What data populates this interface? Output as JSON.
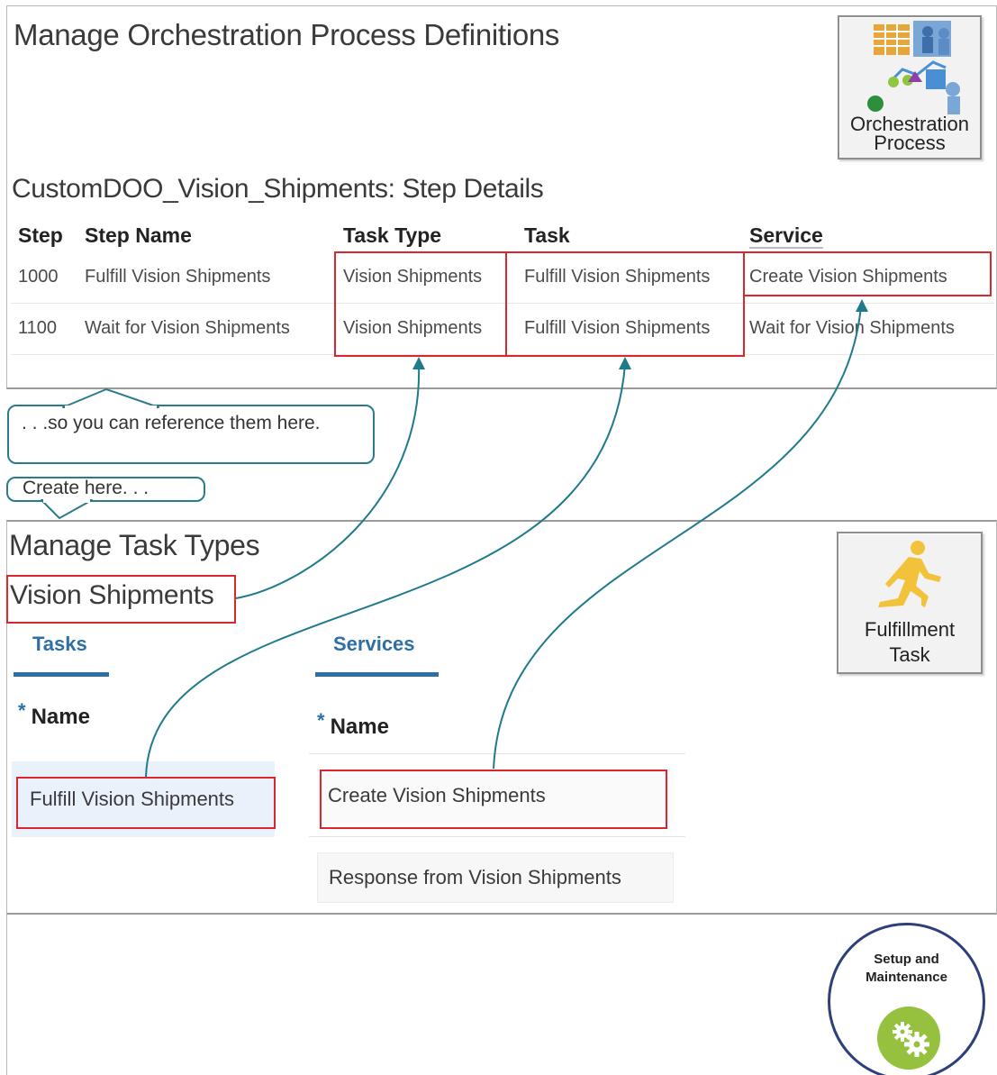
{
  "top_section": {
    "title": "Manage Orchestration Process Definitions",
    "tile_label_line1": "Orchestration",
    "tile_label_line2": "Process",
    "step_details_title": "CustomDOO_Vision_Shipments: Step Details",
    "columns": [
      "Step",
      "Step Name",
      "Task Type",
      "Task",
      "Service"
    ],
    "rows": [
      {
        "step": "1000",
        "step_name": "Fulfill Vision Shipments",
        "task_type": "Vision Shipments",
        "task": "Fulfill Vision Shipments",
        "service": "Create Vision Shipments"
      },
      {
        "step": "1100",
        "step_name": "Wait for Vision Shipments",
        "task_type": "Vision Shipments",
        "task": "Fulfill Vision Shipments",
        "service": "Wait for Vision Shipments"
      }
    ]
  },
  "callouts": {
    "reference_text": ". . .so you can reference  them here.",
    "create_text": "Create  here. . ."
  },
  "middle_section": {
    "title": "Manage Task Types",
    "task_type_name": "Vision Shipments",
    "tile_label_line1": "Fulfillment",
    "tile_label_line2": "Task",
    "tabs": {
      "tasks": "Tasks",
      "services": "Services"
    },
    "required_marker": "*",
    "name_label": "Name",
    "task_items": [
      "Fulfill Vision Shipments"
    ],
    "service_items": [
      "Create Vision Shipments",
      "Response from Vision Shipments"
    ]
  },
  "bottom_section": {
    "badge_line1": "Setup and",
    "badge_line2": "Maintenance"
  },
  "colors": {
    "highlight": "#d9262f",
    "callout_stroke": "#2a7c8c",
    "tab_accent": "#2e6fa6",
    "badge_green": "#95c13e"
  }
}
